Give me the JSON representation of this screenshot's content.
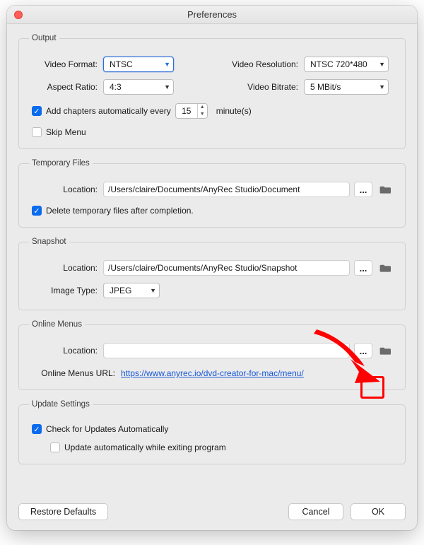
{
  "window": {
    "title": "Preferences"
  },
  "output": {
    "legend": "Output",
    "video_format_label": "Video Format:",
    "video_format_value": "NTSC",
    "aspect_ratio_label": "Aspect Ratio:",
    "aspect_ratio_value": "4:3",
    "video_resolution_label": "Video Resolution:",
    "video_resolution_value": "NTSC 720*480",
    "video_bitrate_label": "Video Bitrate:",
    "video_bitrate_value": "5 MBit/s",
    "chapters_checkbox_label": "Add chapters automatically every",
    "chapters_checked": true,
    "chapters_minutes": "15",
    "chapters_suffix": "minute(s)",
    "skip_menu_label": "Skip Menu",
    "skip_menu_checked": false
  },
  "temp": {
    "legend": "Temporary Files",
    "location_label": "Location:",
    "location_value": "/Users/claire/Documents/AnyRec Studio/Document",
    "delete_label": "Delete temporary files after completion.",
    "delete_checked": true
  },
  "snapshot": {
    "legend": "Snapshot",
    "location_label": "Location:",
    "location_value": "/Users/claire/Documents/AnyRec Studio/Snapshot",
    "image_type_label": "Image Type:",
    "image_type_value": "JPEG"
  },
  "online": {
    "legend": "Online Menus",
    "location_label": "Location:",
    "location_value": "",
    "url_label": "Online Menus URL:",
    "url_value": "https://www.anyrec.io/dvd-creator-for-mac/menu/"
  },
  "update": {
    "legend": "Update Settings",
    "auto_check_label": "Check for Updates Automatically",
    "auto_check_checked": true,
    "auto_exit_label": "Update automatically while exiting program",
    "auto_exit_checked": false
  },
  "footer": {
    "restore": "Restore Defaults",
    "cancel": "Cancel",
    "ok": "OK"
  },
  "icons": {
    "ellipsis": "...",
    "caret": "▼"
  }
}
